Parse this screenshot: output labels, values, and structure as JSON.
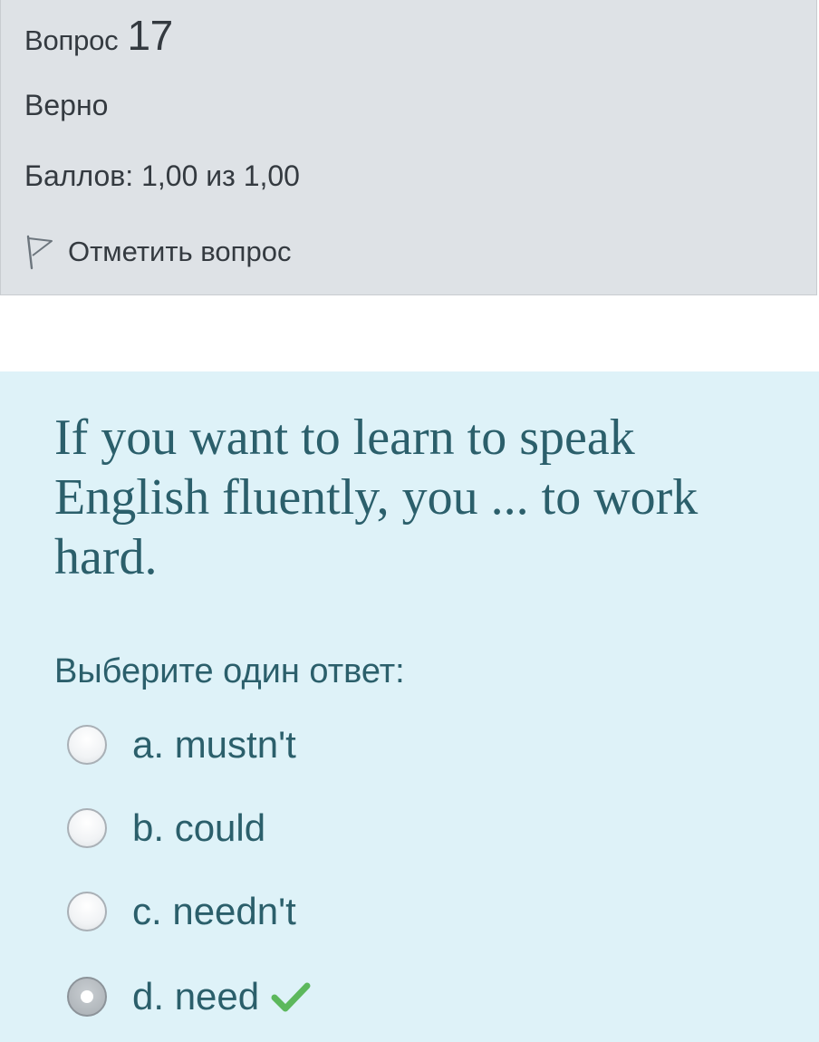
{
  "question_info": {
    "label": "Вопрос",
    "number": "17",
    "state": "Верно",
    "grade": "Баллов: 1,00 из 1,00",
    "flag_label": "Отметить вопрос",
    "flag_icon": "flag-outline-icon"
  },
  "question": {
    "text": "If you want to learn to speak English fluently, you ... to work hard.",
    "prompt": "Выберите один ответ:",
    "options": [
      {
        "label": "a. mustn't",
        "selected": false
      },
      {
        "label": "b. could",
        "selected": false
      },
      {
        "label": "c. needn't",
        "selected": false
      },
      {
        "label": "d. need",
        "selected": true,
        "correct": true
      }
    ]
  },
  "colors": {
    "info_bg": "#dee2e6",
    "question_bg": "#def2f8",
    "question_text": "#2b5f6b",
    "correct_check": "#5cb85c"
  },
  "icons": {
    "correct": "check-icon"
  }
}
